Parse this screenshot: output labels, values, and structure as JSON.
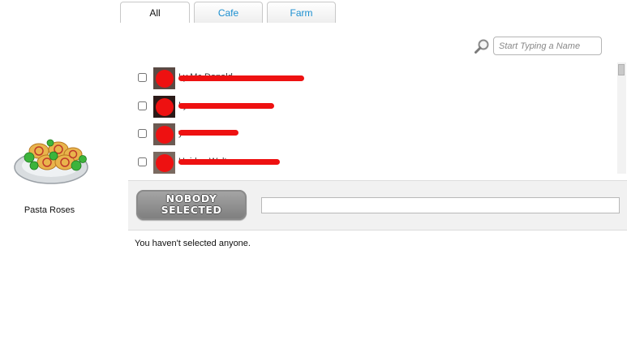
{
  "tabs": [
    {
      "label": "All",
      "active": true
    },
    {
      "label": "Cafe",
      "active": false
    },
    {
      "label": "Farm",
      "active": false
    }
  ],
  "search": {
    "placeholder": "Start Typing a Name",
    "value": ""
  },
  "friends": [
    {
      "name": "Ly Mc Donald",
      "checked": false
    },
    {
      "name": "Ly",
      "checked": false
    },
    {
      "name": "y",
      "checked": false
    },
    {
      "name": "Haiden Walt",
      "checked": false
    }
  ],
  "selection": {
    "badge_line1": "NOBODY",
    "badge_line2": "SELECTED",
    "message_value": "",
    "status_text": "You haven't selected anyone."
  },
  "gift": {
    "name": "Pasta Roses",
    "icon": "pasta-roses-plate"
  },
  "colors": {
    "accent": "#1c8fd0",
    "redaction": "#ee1111"
  }
}
